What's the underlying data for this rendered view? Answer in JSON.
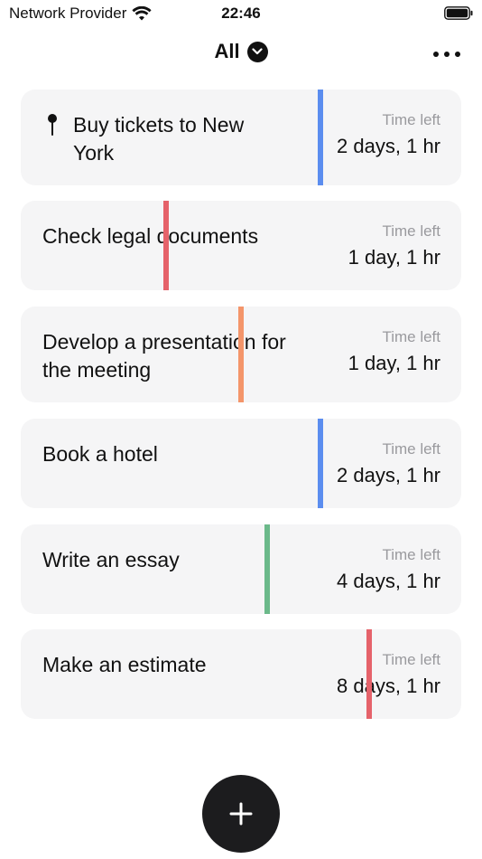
{
  "status_bar": {
    "carrier": "Network Provider",
    "time": "22:46",
    "icons": [
      "wifi-icon",
      "battery-icon"
    ]
  },
  "nav": {
    "filter_label": "All",
    "filter_icon": "chevron-down-circle-icon",
    "more_icon": "ellipsis-icon"
  },
  "tasks": [
    {
      "title": "Buy tickets to New York",
      "pinned": true,
      "time_left_label": "Time left",
      "time_left": "2 days, 1 hr",
      "progress_color": "#5b8def",
      "progress": 0.68
    },
    {
      "title": "Check legal documents",
      "pinned": false,
      "time_left_label": "Time left",
      "time_left": "1 day, 1 hr",
      "progress_color": "#e5626a",
      "progress": 0.33
    },
    {
      "title": "Develop a presentation for the meeting",
      "pinned": false,
      "time_left_label": "Time left",
      "time_left": "1 day, 1 hr",
      "progress_color": "#f4956a",
      "progress": 0.5
    },
    {
      "title": "Book a hotel",
      "pinned": false,
      "time_left_label": "Time left",
      "time_left": "2 days, 1 hr",
      "progress_color": "#5b8def",
      "progress": 0.68
    },
    {
      "title": "Write an essay",
      "pinned": false,
      "time_left_label": "Time left",
      "time_left": "4 days, 1 hr",
      "progress_color": "#6bb98a",
      "progress": 0.56
    },
    {
      "title": "Make an estimate",
      "pinned": false,
      "time_left_label": "Time left",
      "time_left": "8 days, 1 hr",
      "progress_color": "#e5626a",
      "progress": 0.79
    }
  ],
  "fab": {
    "icon": "plus-icon"
  }
}
